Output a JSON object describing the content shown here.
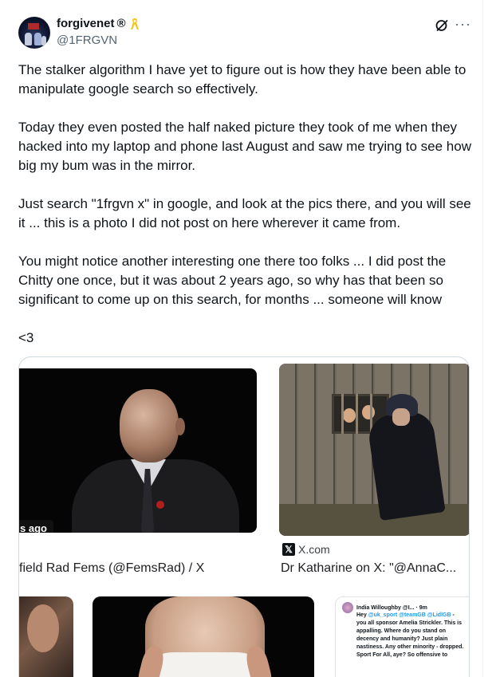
{
  "tweet": {
    "author": {
      "display_name": "forgivenet",
      "reg_mark": "®",
      "handle": "@1FRGVN",
      "badge_icon": "yellow-ribbon-icon"
    },
    "actions": {
      "grok_icon": "grok-icon",
      "more_label": "···"
    },
    "paragraphs": [
      "The stalker algorithm I have yet to figure out is how they have been able to manipulate google search so effectively.",
      "Today they even posted the half naked picture they took of me when they hacked into my laptop and phone last August and saw me trying to see how big my bum was in the mirror.",
      "Just search \"1frgvn x\" in google, and look at the pics there, and you will see it ... this is a photo I did not post on here wherever it came from.",
      "You might notice another interesting one there too folks ... I did post the Chitty one once, but it was about 2 years ago, so why has that been so significant to come up on this search, for months ... someone will know",
      "<3"
    ]
  },
  "media": {
    "results": [
      {
        "badge": "s ago",
        "title": "field Rad Fems (@FemsRad) / X"
      },
      {
        "source": "X.com",
        "title": "Dr Katharine on X: \"@AnnaC..."
      }
    ],
    "embedded_tweet": {
      "name": "India Willoughby @I... · 9m",
      "mention_prefix": "Hey",
      "mentions": "@uk_sport @teamGB @LidlGB",
      "body": " - you all sponsor Amelia Strickler. This is appalling. Where do you stand on decency and humanity? Just plain nastiness. Any other minority - dropped. Sport For All, aye? So offensive to"
    }
  },
  "colors": {
    "text": "#0f1419",
    "secondary": "#536471",
    "border": "#cfd9de",
    "link": "#1d9bf0",
    "ribbon": "#f5c518"
  }
}
